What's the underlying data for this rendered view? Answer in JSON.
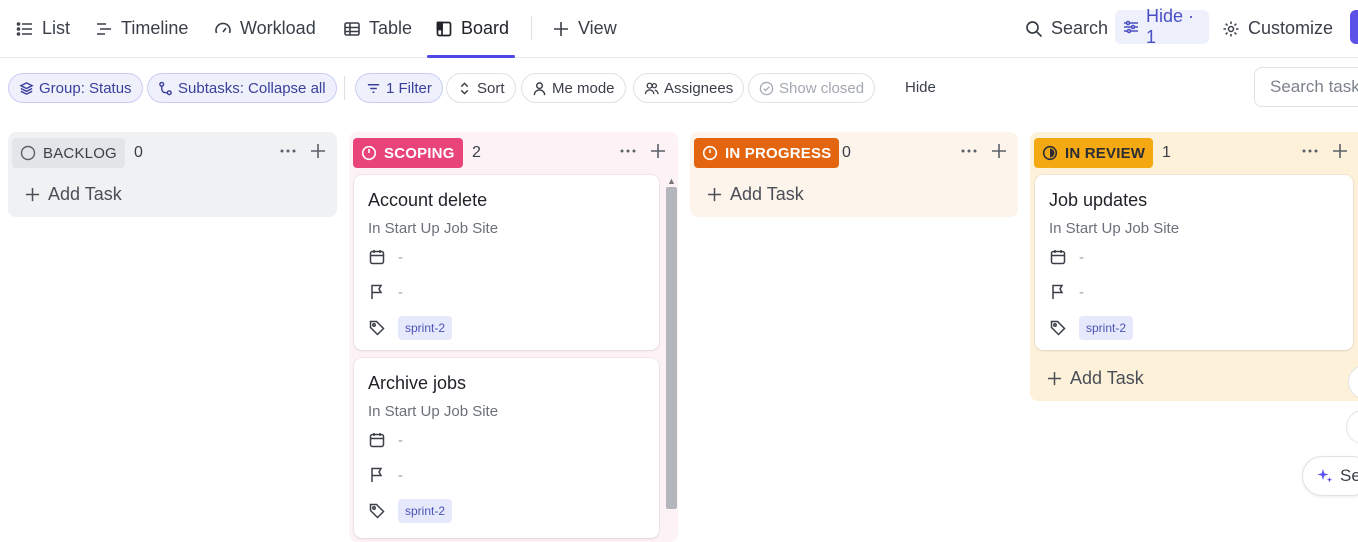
{
  "nav": {
    "tabs": [
      {
        "label": "List",
        "icon": "list-icon"
      },
      {
        "label": "Timeline",
        "icon": "timeline-icon"
      },
      {
        "label": "Workload",
        "icon": "gauge-icon"
      },
      {
        "label": "Table",
        "icon": "table-icon"
      },
      {
        "label": "Board",
        "icon": "board-icon",
        "active": true
      },
      {
        "label": "View",
        "icon": "plus-icon"
      }
    ],
    "search_label": "Search",
    "hide_label": "Hide · 1",
    "customize_label": "Customize",
    "accent_color": "#4f46e5"
  },
  "toolbar": {
    "group": "Group: Status",
    "subtasks": "Subtasks: Collapse all",
    "filter": "1 Filter",
    "sort": "Sort",
    "me_mode": "Me mode",
    "assignees": "Assignees",
    "show_closed": "Show closed",
    "hide": "Hide",
    "search_placeholder": "Search task"
  },
  "columns": [
    {
      "status": "BACKLOG",
      "count": "0",
      "color": "#f0f1f3",
      "pill_color": "#e3e5e8",
      "add_task": "Add Task",
      "tasks": []
    },
    {
      "status": "SCOPING",
      "count": "2",
      "color": "#fdf2f5",
      "pill_color": "#e8447a",
      "add_task": "Add Task",
      "tasks": [
        {
          "title": "Account delete",
          "location": "In Start Up Job Site",
          "date": "-",
          "priority": "-",
          "tag": "sprint-2"
        },
        {
          "title": "Archive jobs",
          "location": "In Start Up Job Site",
          "date": "-",
          "priority": "-",
          "tag": "sprint-2"
        }
      ]
    },
    {
      "status": "IN PROGRESS",
      "count": "0",
      "color": "#fdf4ec",
      "pill_color": "#e4650f",
      "add_task": "Add Task",
      "tasks": []
    },
    {
      "status": "IN REVIEW",
      "count": "1",
      "color": "#fdf1d9",
      "pill_color": "#f4a812",
      "add_task": "Add Task",
      "tasks": [
        {
          "title": "Job updates",
          "location": "In Start Up Job Site",
          "date": "-",
          "priority": "-",
          "tag": "sprint-2"
        }
      ]
    }
  ],
  "ai_button_label": "Sea"
}
